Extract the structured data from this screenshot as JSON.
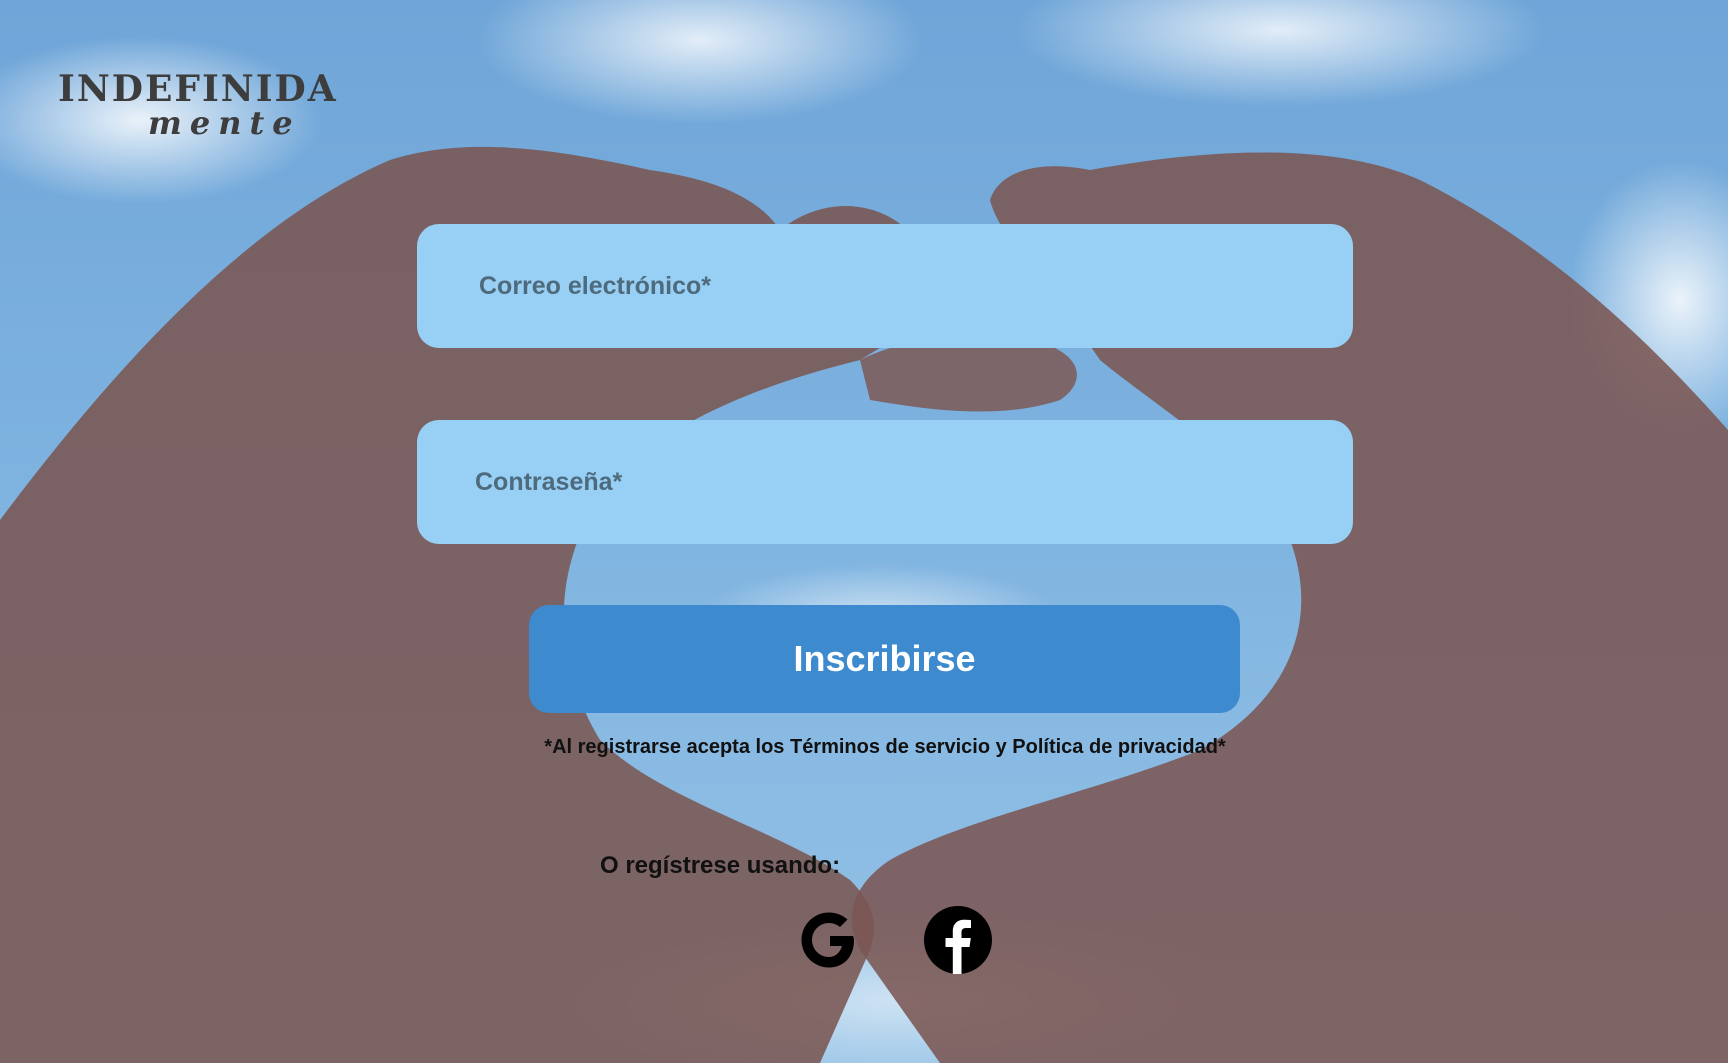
{
  "logo": {
    "main": "INDEFINIDA",
    "sub": "mente"
  },
  "form": {
    "email_placeholder": "Correo electrónico*",
    "password_placeholder": "Contraseña*",
    "submit_label": "Inscribirse",
    "terms": "*Al registrarse acepta los Términos de servicio y Política de privacidad*"
  },
  "social": {
    "prompt": "O regístrese usando:",
    "providers": [
      {
        "name": "Google",
        "icon": "google-icon"
      },
      {
        "name": "Facebook",
        "icon": "facebook-icon"
      }
    ]
  },
  "colors": {
    "input_bg": "#98cff4",
    "button_bg": "#3d8bce",
    "button_text": "#ffffff",
    "logo_text": "#3d3d3d"
  }
}
